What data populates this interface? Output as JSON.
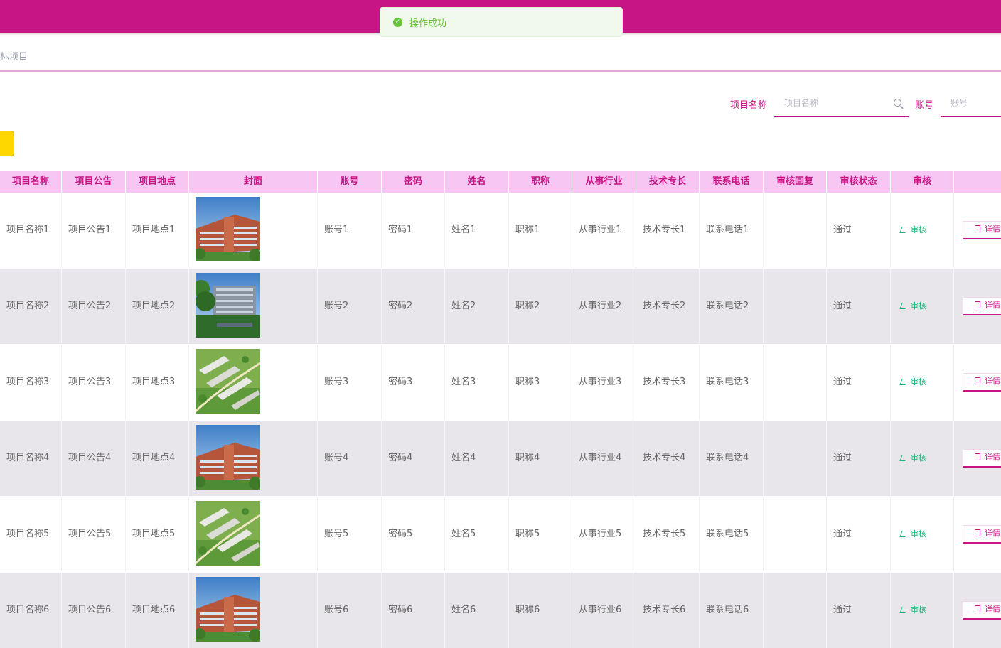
{
  "toast": {
    "text": "操作成功"
  },
  "breadcrumb": {
    "text": "标项目"
  },
  "search": {
    "project_name_label": "项目名称",
    "project_name_placeholder": "项目名称",
    "account_label": "账号",
    "account_placeholder": "账号"
  },
  "table": {
    "headers": [
      "项目名称",
      "项目公告",
      "项目地点",
      "封面",
      "账号",
      "密码",
      "姓名",
      "职称",
      "从事行业",
      "技术专长",
      "联系电话",
      "审核回复",
      "审核状态",
      "审核",
      ""
    ],
    "audit_label": "审核",
    "detail_label": "详情",
    "rows": [
      {
        "name": "项目名称1",
        "notice": "项目公告1",
        "location": "项目地点1",
        "cover": "building-red",
        "account": "账号1",
        "password": "密码1",
        "person": "姓名1",
        "title": "职称1",
        "industry": "从事行业1",
        "skill": "技术专长1",
        "phone": "联系电话1",
        "reply": "",
        "status": "通过"
      },
      {
        "name": "项目名称2",
        "notice": "项目公告2",
        "location": "项目地点2",
        "cover": "building-gray",
        "account": "账号2",
        "password": "密码2",
        "person": "姓名2",
        "title": "职称2",
        "industry": "从事行业2",
        "skill": "技术专长2",
        "phone": "联系电话2",
        "reply": "",
        "status": "通过"
      },
      {
        "name": "项目名称3",
        "notice": "项目公告3",
        "location": "项目地点3",
        "cover": "aerial-green",
        "account": "账号3",
        "password": "密码3",
        "person": "姓名3",
        "title": "职称3",
        "industry": "从事行业3",
        "skill": "技术专长3",
        "phone": "联系电话3",
        "reply": "",
        "status": "通过"
      },
      {
        "name": "项目名称4",
        "notice": "项目公告4",
        "location": "项目地点4",
        "cover": "building-red",
        "account": "账号4",
        "password": "密码4",
        "person": "姓名4",
        "title": "职称4",
        "industry": "从事行业4",
        "skill": "技术专长4",
        "phone": "联系电话4",
        "reply": "",
        "status": "通过"
      },
      {
        "name": "项目名称5",
        "notice": "项目公告5",
        "location": "项目地点5",
        "cover": "aerial-green",
        "account": "账号5",
        "password": "密码5",
        "person": "姓名5",
        "title": "职称5",
        "industry": "从事行业5",
        "skill": "技术专长5",
        "phone": "联系电话5",
        "reply": "",
        "status": "通过"
      },
      {
        "name": "项目名称6",
        "notice": "项目公告6",
        "location": "项目地点6",
        "cover": "building-red",
        "account": "账号6",
        "password": "密码6",
        "person": "姓名6",
        "title": "职称6",
        "industry": "从事行业6",
        "skill": "技术专长6",
        "phone": "联系电话6",
        "reply": "",
        "status": "通过"
      }
    ]
  },
  "colors": {
    "primary": "#c71585",
    "header_bg": "#f7c6f2",
    "success": "#67c23a",
    "audit": "#17b978",
    "accent_button": "#ffd700"
  }
}
